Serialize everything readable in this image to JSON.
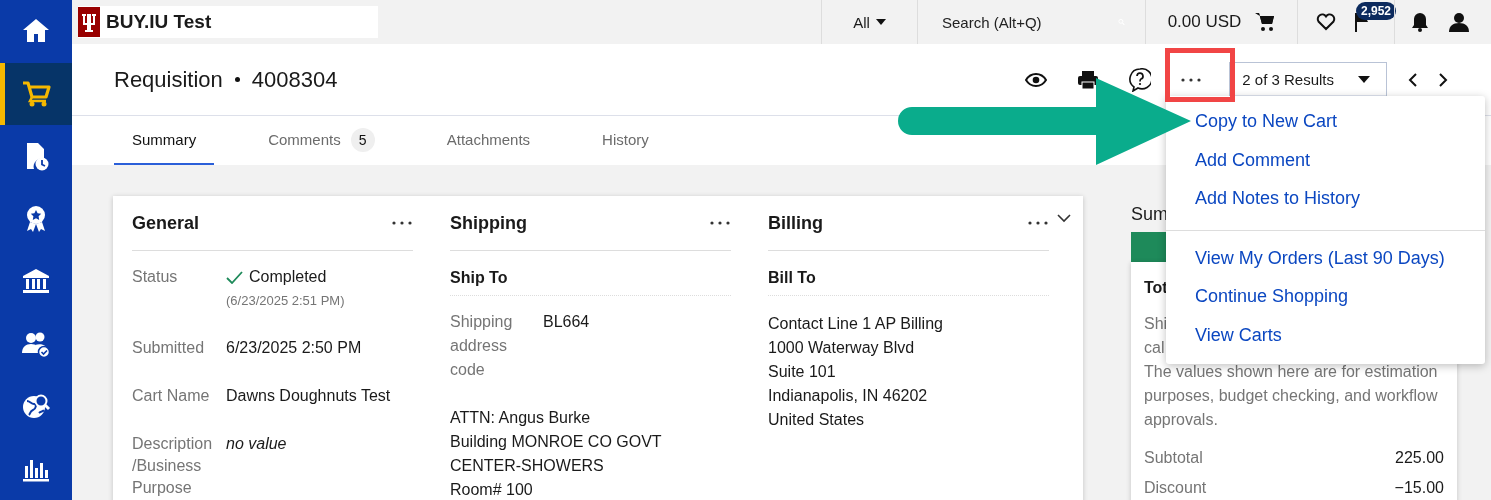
{
  "sidebar": {
    "items": [
      {
        "selected": false
      },
      {
        "selected": true
      },
      {
        "selected": false
      },
      {
        "selected": false
      },
      {
        "selected": false
      },
      {
        "selected": false
      },
      {
        "selected": false
      },
      {
        "selected": false
      }
    ]
  },
  "top_bar": {
    "logo_text": "BUY.IU Test",
    "scope": "All",
    "search": {
      "placeholder": "Search (Alt+Q)"
    },
    "cart_total": "0.00 USD",
    "flag_badge": "2,952"
  },
  "header": {
    "title": "Requisition",
    "number": "4008304",
    "results": "2 of 3 Results"
  },
  "tabs": [
    {
      "label": "Summary",
      "selected": true
    },
    {
      "label": "Comments",
      "badge": "5",
      "selected": false
    },
    {
      "label": "Attachments",
      "selected": false
    },
    {
      "label": "History",
      "selected": false
    }
  ],
  "general": {
    "title": "General",
    "fields": [
      {
        "kind": "status",
        "label": "Status",
        "value": "Completed",
        "note": "(6/23/2025 2:51 PM)"
      },
      {
        "kind": "text",
        "label": "Submitted",
        "value": "6/23/2025 2:50 PM"
      },
      {
        "kind": "text",
        "label": "Cart Name",
        "value": "Dawns Doughnuts Test"
      },
      {
        "kind": "empty",
        "label": "Description /Business Purpose",
        "value": "no value"
      }
    ]
  },
  "shipping": {
    "title": "Shipping",
    "subtitle": "Ship To",
    "fields": [
      {
        "kind": "text",
        "label": "Shipping address code",
        "value": "BL664"
      }
    ],
    "address": [
      "ATTN: Angus Burke",
      "Building MONROE CO GOVT CENTER-SHOWERS",
      "Room# 100"
    ]
  },
  "billing": {
    "title": "Billing",
    "subtitle": "Bill To",
    "address": [
      "Contact Line 1 AP Billing",
      "1000 Waterway Blvd",
      "Suite 101",
      "Indianapolis, IN 46202",
      "United States"
    ]
  },
  "summary": {
    "title": "Sum",
    "card_title": "Tot",
    "cut_lines": [
      "Shi",
      "cal"
    ],
    "note": "The values shown here are for estimation purposes, budget checking, and workflow approvals.",
    "rows": [
      {
        "label": "Subtotal",
        "value": "225.00"
      },
      {
        "label": "Discount",
        "value": "−15.00"
      }
    ]
  },
  "menu": {
    "groups": [
      [
        "Copy to New Cart",
        "Add Comment",
        "Add Notes to History"
      ],
      [
        "View My Orders (Last 90 Days)",
        "Continue Shopping",
        "View Carts"
      ]
    ]
  }
}
